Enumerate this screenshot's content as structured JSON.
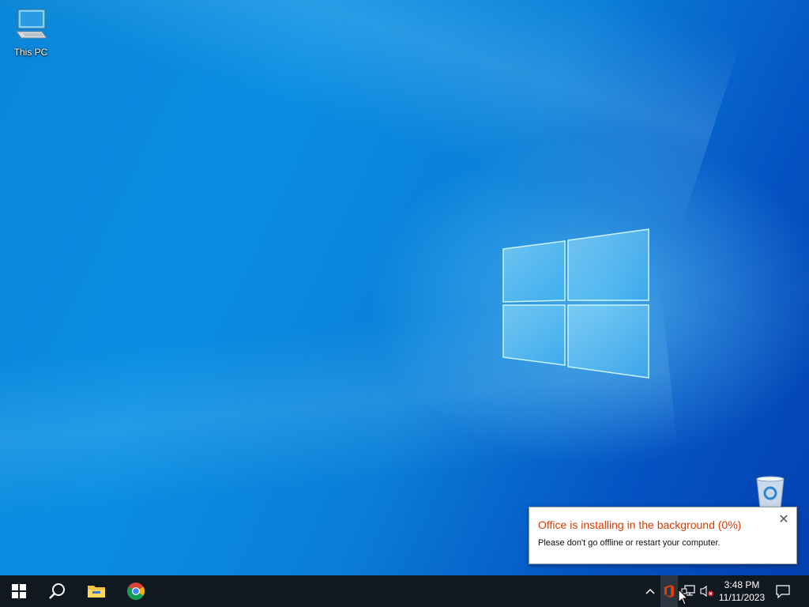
{
  "desktop": {
    "icons": [
      {
        "label": "This PC",
        "icon": "this-pc-icon"
      },
      {
        "label": "",
        "icon": "recycle-bin-icon"
      }
    ]
  },
  "toast": {
    "title": "Office is installing in the background (0%)",
    "message": "Please don't go offline or restart your computer.",
    "progress_percent": 0,
    "title_color": "#d83b01"
  },
  "taskbar": {
    "buttons": [
      {
        "icon": "windows-start-icon"
      },
      {
        "icon": "search-icon"
      },
      {
        "icon": "file-explorer-icon"
      },
      {
        "icon": "chrome-icon"
      }
    ],
    "tray": {
      "icons": [
        "chevron-up-icon",
        "office-icon",
        "network-icon",
        "volume-muted-icon"
      ],
      "time": "3:48 PM",
      "date": "11/11/2023",
      "notification_icon": "action-center-icon"
    }
  },
  "colors": {
    "taskbar_bg": "#101820",
    "desktop_blue": "#0a86d8"
  }
}
